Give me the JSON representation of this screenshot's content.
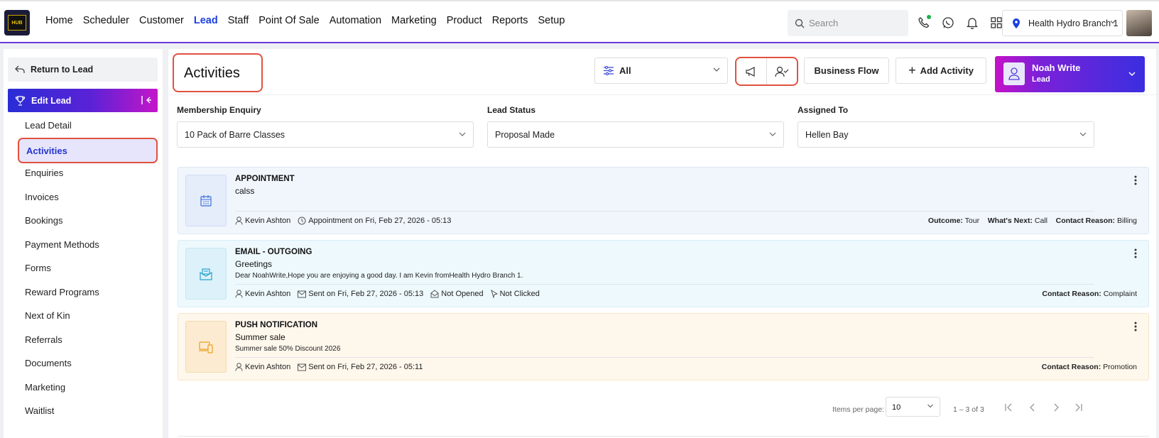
{
  "app": {
    "logo_text": "HUB"
  },
  "nav": {
    "items": [
      "Home",
      "Scheduler",
      "Customer",
      "Lead",
      "Staff",
      "Point Of Sale",
      "Automation",
      "Marketing",
      "Product",
      "Reports",
      "Setup"
    ],
    "active": "Lead"
  },
  "search": {
    "placeholder": "Search"
  },
  "branch": {
    "name": "Health Hydro Branch 1"
  },
  "sidebar": {
    "return_label": "Return to Lead",
    "edit_label": "Edit Lead",
    "items": [
      "Lead Detail",
      "Activities",
      "Enquiries",
      "Invoices",
      "Bookings",
      "Payment Methods",
      "Forms",
      "Reward Programs",
      "Next of Kin",
      "Referrals",
      "Documents",
      "Marketing",
      "Waitlist"
    ],
    "active": "Activities"
  },
  "page": {
    "title": "Activities",
    "filter_value": "All",
    "business_flow_label": "Business Flow",
    "add_activity_label": "Add Activity"
  },
  "lead": {
    "name": "Noah Write",
    "role": "Lead"
  },
  "fields": {
    "membership_label": "Membership Enquiry",
    "membership_value": "10 Pack of Barre Classes",
    "status_label": "Lead Status",
    "status_value": "Proposal Made",
    "assigned_label": "Assigned To",
    "assigned_value": "Hellen Bay"
  },
  "activities": [
    {
      "type": "APPOINTMENT",
      "subject": "calss",
      "description": "",
      "staff": "Kevin Ashton",
      "when": "Appointment on Fri, Feb 27, 2026 - 05:13",
      "opened": "",
      "clicked": "",
      "right": [
        {
          "k": "Outcome:",
          "v": "Tour"
        },
        {
          "k": "What's Next:",
          "v": "Call"
        },
        {
          "k": "Contact Reason:",
          "v": "Billing"
        }
      ]
    },
    {
      "type": "EMAIL - OUTGOING",
      "subject": "Greetings",
      "description": "Dear NoahWrite,Hope you are enjoying a good day. I am Kevin fromHealth Hydro Branch 1.",
      "staff": "Kevin Ashton",
      "when": "Sent on Fri, Feb 27, 2026 - 05:13",
      "opened": "Not Opened",
      "clicked": "Not Clicked",
      "right": [
        {
          "k": "Contact Reason:",
          "v": "Complaint"
        }
      ]
    },
    {
      "type": "PUSH NOTIFICATION",
      "subject": "Summer sale",
      "description": "Summer sale 50% Discount 2026",
      "staff": "Kevin Ashton",
      "when": "Sent on Fri, Feb 27, 2026 - 05:11",
      "opened": "",
      "clicked": "",
      "right": [
        {
          "k": "Contact Reason:",
          "v": "Promotion"
        }
      ]
    }
  ],
  "pagination": {
    "items_per_page_label": "Items per page:",
    "items_per_page": "10",
    "range": "1 – 3 of 3"
  },
  "colors": {
    "accent": "#1a3fe0",
    "highlight_border": "#e0523f",
    "nav_underline": "#6a3cd8"
  }
}
